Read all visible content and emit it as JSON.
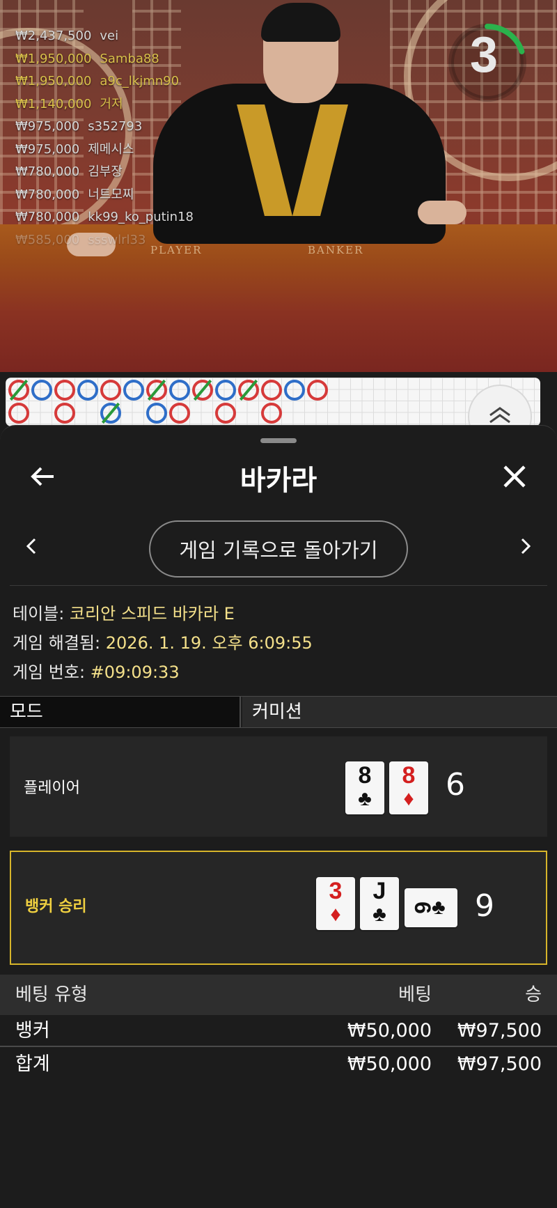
{
  "top_bets": [
    {
      "amount": "₩2,437,500",
      "name": "vei",
      "highlight": false
    },
    {
      "amount": "₩1,950,000",
      "name": "Samba88",
      "highlight": true
    },
    {
      "amount": "₩1,950,000",
      "name": "a9c_lkjmn90",
      "highlight": true
    },
    {
      "amount": "₩1,140,000",
      "name": "거저",
      "highlight": true
    },
    {
      "amount": "₩975,000",
      "name": "s352793",
      "highlight": false
    },
    {
      "amount": "₩975,000",
      "name": "제메시스",
      "highlight": false
    },
    {
      "amount": "₩780,000",
      "name": "김부장",
      "highlight": false
    },
    {
      "amount": "₩780,000",
      "name": "너트모찌",
      "highlight": false
    },
    {
      "amount": "₩780,000",
      "name": "kk99_ko_putin18",
      "highlight": false
    },
    {
      "amount": "₩585,000",
      "name": "ssswlrl33",
      "highlight": false
    }
  ],
  "table_labels": {
    "player": "PLAYER",
    "banker": "BANKER"
  },
  "timer": {
    "count": "3",
    "progress": 0.2,
    "color": "#2bb24c"
  },
  "roadmap": {
    "icon": "chevron-double-up-icon",
    "row1": [
      "B-tie",
      "P",
      "B",
      "P",
      "B",
      "P",
      "B-tie",
      "P",
      "B-tie",
      "P",
      "B-tie",
      "B",
      "P",
      "B"
    ],
    "row2": [
      "B",
      "",
      "B",
      "",
      "P-tie",
      "",
      "P",
      "B",
      "",
      "B",
      "",
      "B",
      "",
      ""
    ]
  },
  "sheet": {
    "title": "바카라",
    "back_icon": "arrow-left-icon",
    "close_icon": "close-icon",
    "prev_icon": "chevron-left-icon",
    "next_icon": "chevron-right-icon",
    "history_button": "게임 기록으로 돌아가기"
  },
  "info": {
    "table_label": "테이블:",
    "table_value": "코리안 스피드 바카라 E",
    "resolved_label": "게임 해결됨:",
    "resolved_value": "2026. 1. 19. 오후 6:09:55",
    "game_no_label": "게임 번호:",
    "game_no_value": "#09:09:33"
  },
  "mode": {
    "label": "모드",
    "value": "커미션"
  },
  "player": {
    "label": "플레이어",
    "score": "6",
    "cards": [
      {
        "rank": "8",
        "suit": "♣",
        "color": "black"
      },
      {
        "rank": "8",
        "suit": "♦",
        "color": "red"
      }
    ]
  },
  "banker": {
    "label": "뱅커 승리",
    "label_color": "#f0d040",
    "score": "9",
    "cards": [
      {
        "rank": "3",
        "suit": "♦",
        "color": "red"
      },
      {
        "rank": "J",
        "suit": "♣",
        "color": "black"
      },
      {
        "rank": "6",
        "suit": "♣",
        "color": "black",
        "sideways": true
      }
    ]
  },
  "bets": {
    "headers": {
      "type": "베팅 유형",
      "bet": "베팅",
      "win": "승"
    },
    "rows": [
      {
        "type": "뱅커",
        "bet": "₩50,000",
        "win": "₩97,500"
      }
    ],
    "total": {
      "type": "합계",
      "bet": "₩50,000",
      "win": "₩97,500"
    }
  }
}
